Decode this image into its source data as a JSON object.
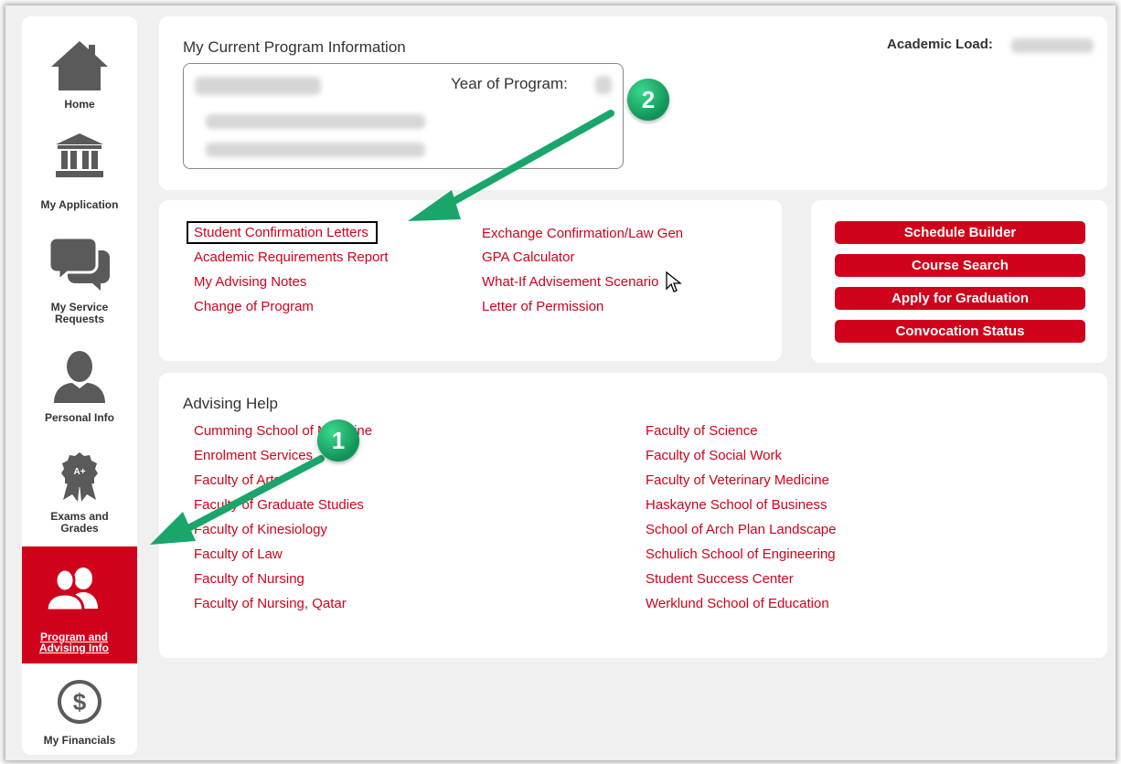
{
  "sidebar": {
    "items": [
      {
        "label": "Home",
        "icon": "home-icon"
      },
      {
        "label": "My Application",
        "icon": "bank-icon"
      },
      {
        "label_line1": "My Service",
        "label_line2": "Requests",
        "icon": "chat-icon"
      },
      {
        "label": "Personal Info",
        "icon": "person-icon"
      },
      {
        "label_line1": "Exams and",
        "label_line2": "Grades",
        "icon": "award-icon",
        "badge_text": "A+"
      },
      {
        "label_line1": "Program and",
        "label_line2": "Advising Info",
        "icon": "users-icon"
      },
      {
        "label": "My Financials",
        "icon": "dollar-icon",
        "symbol": "$"
      }
    ]
  },
  "program_info": {
    "title": "My Current Program Information",
    "year_label": "Year of Program:",
    "academic_load_label": "Academic Load:"
  },
  "links": {
    "left": [
      "Student Confirmation Letters",
      "Academic Requirements Report",
      "My Advising Notes",
      "Change of Program"
    ],
    "right": [
      "Exchange Confirmation/Law Gen",
      "GPA Calculator",
      "What-If Advisement Scenario",
      "Letter of Permission"
    ]
  },
  "actions": [
    "Schedule Builder",
    "Course Search",
    "Apply for Graduation",
    "Convocation Status"
  ],
  "advising": {
    "title": "Advising Help",
    "left": [
      "Cumming School of Medicine",
      "Enrolment Services",
      "Faculty of Arts",
      "Faculty of Graduate Studies",
      "Faculty of Kinesiology",
      "Faculty of Law",
      "Faculty of Nursing",
      "Faculty of Nursing, Qatar"
    ],
    "right": [
      "Faculty of Science",
      "Faculty of Social Work",
      "Faculty of Veterinary Medicine",
      "Haskayne School of Business",
      "School of Arch Plan Landscape",
      "Schulich School of Engineering",
      "Student Success Center",
      "Werklund School of Education"
    ]
  },
  "annotations": {
    "badge1": "1",
    "badge2": "2"
  },
  "colors": {
    "accent": "#d0021b",
    "arrow": "#1aa56b",
    "background": "#f0f0f0"
  }
}
